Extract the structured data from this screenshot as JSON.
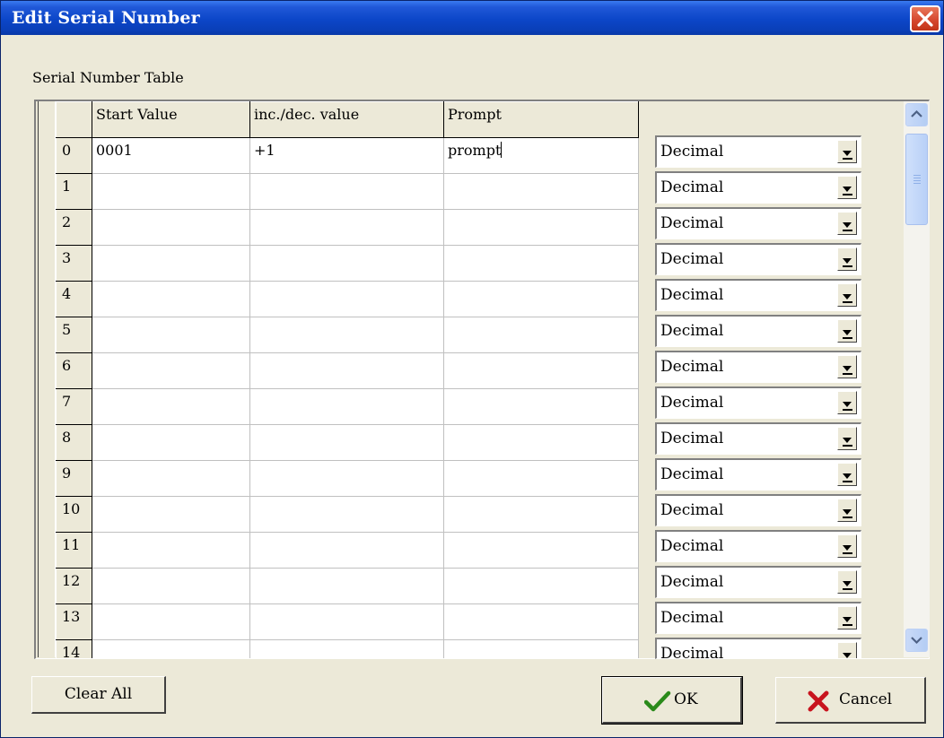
{
  "window": {
    "title": "Edit Serial Number"
  },
  "group_label": "Serial Number Table",
  "table": {
    "columns": [
      "Start Value",
      "inc./dec. value",
      "Prompt"
    ],
    "rows": [
      {
        "index": "0",
        "start_value": "0001",
        "inc_dec_value": "+1",
        "prompt": "prompt",
        "format": "Decimal"
      },
      {
        "index": "1",
        "start_value": "",
        "inc_dec_value": "",
        "prompt": "",
        "format": "Decimal"
      },
      {
        "index": "2",
        "start_value": "",
        "inc_dec_value": "",
        "prompt": "",
        "format": "Decimal"
      },
      {
        "index": "3",
        "start_value": "",
        "inc_dec_value": "",
        "prompt": "",
        "format": "Decimal"
      },
      {
        "index": "4",
        "start_value": "",
        "inc_dec_value": "",
        "prompt": "",
        "format": "Decimal"
      },
      {
        "index": "5",
        "start_value": "",
        "inc_dec_value": "",
        "prompt": "",
        "format": "Decimal"
      },
      {
        "index": "6",
        "start_value": "",
        "inc_dec_value": "",
        "prompt": "",
        "format": "Decimal"
      },
      {
        "index": "7",
        "start_value": "",
        "inc_dec_value": "",
        "prompt": "",
        "format": "Decimal"
      },
      {
        "index": "8",
        "start_value": "",
        "inc_dec_value": "",
        "prompt": "",
        "format": "Decimal"
      },
      {
        "index": "9",
        "start_value": "",
        "inc_dec_value": "",
        "prompt": "",
        "format": "Decimal"
      },
      {
        "index": "10",
        "start_value": "",
        "inc_dec_value": "",
        "prompt": "",
        "format": "Decimal"
      },
      {
        "index": "11",
        "start_value": "",
        "inc_dec_value": "",
        "prompt": "",
        "format": "Decimal"
      },
      {
        "index": "12",
        "start_value": "",
        "inc_dec_value": "",
        "prompt": "",
        "format": "Decimal"
      },
      {
        "index": "13",
        "start_value": "",
        "inc_dec_value": "",
        "prompt": "",
        "format": "Decimal"
      },
      {
        "index": "14",
        "start_value": "",
        "inc_dec_value": "",
        "prompt": "",
        "format": "Decimal"
      }
    ]
  },
  "buttons": {
    "clear_all": "Clear All",
    "ok": "OK",
    "cancel": "Cancel"
  },
  "icons": {
    "close": "close-icon",
    "ok": "checkmark-icon",
    "cancel": "x-mark-icon",
    "scroll_up": "chevron-up-icon",
    "scroll_down": "chevron-down-icon"
  },
  "colors": {
    "titlebar": "#0a3fb8",
    "dialog_bg": "#ece9d8",
    "ok_check": "#2a8a1a",
    "cancel_x": "#c8141e",
    "close_btn": "#d4452c"
  }
}
